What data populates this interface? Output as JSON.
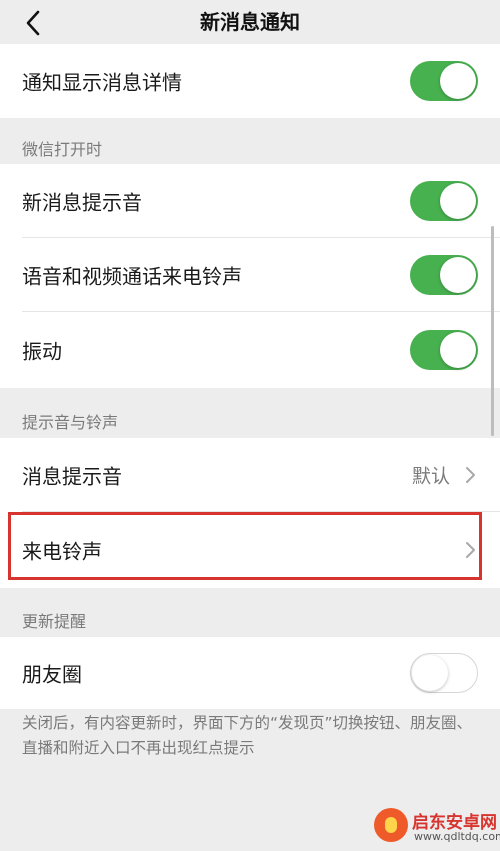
{
  "nav": {
    "title": "新消息通知"
  },
  "rows": {
    "show_details": {
      "label": "通知显示消息详情",
      "enabled": true
    },
    "section_wechat_open": "微信打开时",
    "new_msg_sound": {
      "label": "新消息提示音",
      "enabled": true
    },
    "call_ringtone": {
      "label": "语音和视频通话来电铃声",
      "enabled": true
    },
    "vibrate": {
      "label": "振动",
      "enabled": true
    },
    "section_sounds": "提示音与铃声",
    "msg_sound": {
      "label": "消息提示音",
      "value": "默认"
    },
    "ringtone": {
      "label": "来电铃声"
    },
    "section_updates": "更新提醒",
    "moments": {
      "label": "朋友圈",
      "enabled": false
    }
  },
  "footnote": "关闭后，有内容更新时，界面下方的“发现页”切换按钮、朋友圈、直播和附近入口不再出现红点提示",
  "watermark": {
    "name": "启东安卓网",
    "url": "www.qdltdq.com"
  },
  "colors": {
    "switch_on": "#47b04f",
    "highlight": "#d8342f",
    "background": "#ededed"
  }
}
